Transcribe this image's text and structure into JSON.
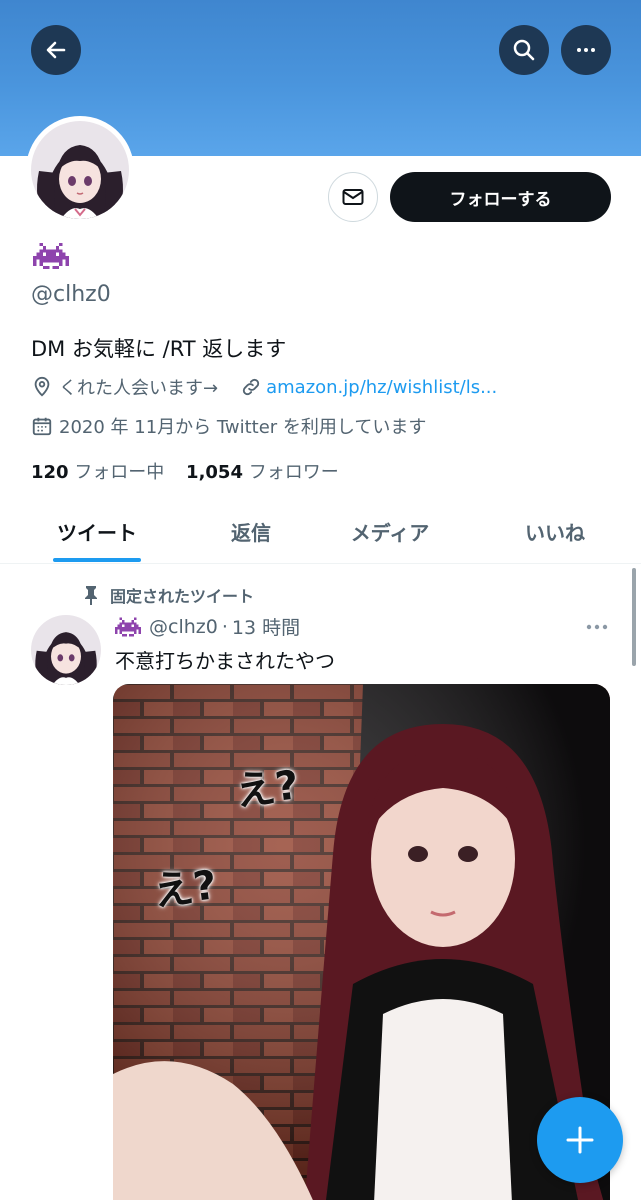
{
  "header": {
    "back_icon": "arrow-left-icon",
    "search_icon": "search-icon",
    "more_icon": "more-horizontal-icon",
    "banner_color": "#4a95dd"
  },
  "profile": {
    "display_name_icon": "space-invader-emoji",
    "handle": "@clhz0",
    "bio": "DM お気軽に /RT 返します",
    "location": "くれた人会います→",
    "link": "amazon.jp/hz/wishlist/ls...",
    "joined": "2020 年 11月から Twitter を利用しています",
    "following_count": "120",
    "following_label": "フォロー中",
    "followers_count": "1,054",
    "followers_label": "フォロワー"
  },
  "actions": {
    "message_icon": "mail-icon",
    "follow_label": "フォローする"
  },
  "tabs": [
    {
      "label": "ツイート",
      "active": true
    },
    {
      "label": "返信",
      "active": false
    },
    {
      "label": "メディア",
      "active": false
    },
    {
      "label": "いいね",
      "active": false
    }
  ],
  "tweet": {
    "pinned_label": "固定されたツイート",
    "pin_icon": "pin-icon",
    "handle": "@clhz0",
    "separator": "·",
    "time": "13 時間",
    "text": "不意打ちかまされたやつ",
    "media_captions": [
      "え?",
      "え?"
    ]
  },
  "fab": {
    "icon": "plus-icon",
    "color": "#1d9bf0"
  }
}
